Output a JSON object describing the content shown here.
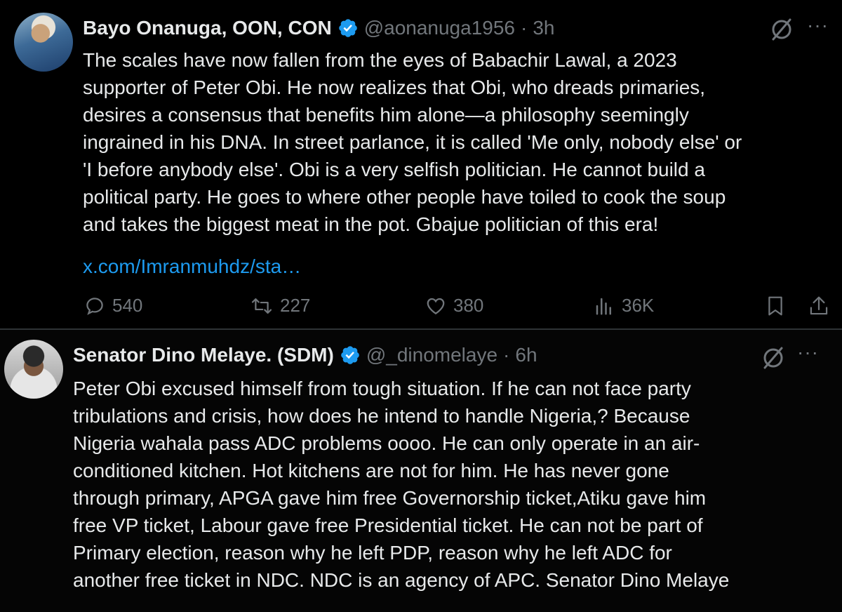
{
  "tweets": [
    {
      "name": "Bayo Onanuga, OON, CON",
      "handle": "@aonanuga1956",
      "dot": "·",
      "time": "3h",
      "more": "···",
      "text": "The scales have now fallen from the eyes of Babachir Lawal, a 2023\nsupporter of Peter Obi. He now realizes that Obi, who dreads primaries,\ndesires a consensus that benefits him alone—a philosophy seemingly\ningrained in his DNA. In street parlance, it is called 'Me only, nobody else' or\n'I before anybody else'. Obi is a very selfish politician. He cannot build a\npolitical party. He goes to where other people have toiled to cook the soup\nand takes the biggest meat in the pot.  Gbajue politician of this era!",
      "link": "x.com/Imranmuhdz/sta…",
      "replies": "540",
      "reposts": "227",
      "likes": "380",
      "views": "36K"
    },
    {
      "name": "Senator Dino Melaye. (SDM)",
      "handle": "@_dinomelaye",
      "dot": "·",
      "time": "6h",
      "more": "···",
      "text": "Peter Obi excused himself from tough situation. If he can not face party\ntribulations and crisis, how does he intend to handle Nigeria,? Because\nNigeria wahala pass ADC problems oooo. He can only operate in an air-\nconditioned kitchen.  Hot kitchens are not for him. He has never gone\nthrough primary, APGA gave him free Governorship ticket,Atiku gave him\nfree VP ticket, Labour gave free Presidential ticket. He can not be part of\nPrimary election, reason why he left PDP, reason why he left ADC for\nanother free ticket in NDC.  NDC is an agency of APC.  Senator Dino Melaye"
    }
  ],
  "colors": {
    "background": "#000000",
    "text": "#e7e9ea",
    "muted": "#71767b",
    "link": "#1d9bf0",
    "verified": "#1d9bf0"
  },
  "icons": [
    "verified-badge-icon",
    "grok-icon",
    "more-icon",
    "reply-icon",
    "repost-icon",
    "like-icon",
    "views-icon",
    "bookmark-icon",
    "share-icon"
  ]
}
